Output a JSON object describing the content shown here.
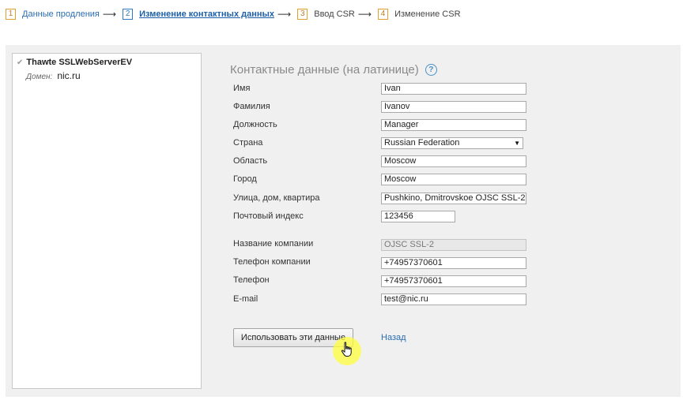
{
  "steps": [
    {
      "num": "1",
      "label": "Данные продления"
    },
    {
      "num": "2",
      "label": "Изменение контактных данных"
    },
    {
      "num": "3",
      "label": "Ввод CSR"
    },
    {
      "num": "4",
      "label": "Изменение CSR"
    }
  ],
  "arrow": "⟶",
  "product": {
    "name": "Thawte SSLWebServerEV",
    "domain_label": "Домен:",
    "domain_value": "nic.ru"
  },
  "form": {
    "title": "Контактные данные (на латинице)",
    "help_glyph": "?",
    "fields": {
      "first_name": {
        "label": "Имя",
        "value": "Ivan"
      },
      "last_name": {
        "label": "Фамилия",
        "value": "Ivanov"
      },
      "position": {
        "label": "Должность",
        "value": "Manager"
      },
      "country": {
        "label": "Страна",
        "value": "Russian Federation"
      },
      "region": {
        "label": "Область",
        "value": "Moscow"
      },
      "city": {
        "label": "Город",
        "value": "Moscow"
      },
      "street": {
        "label": "Улица, дом, квартира",
        "value": "Pushkino, Dmitrovskoe OJSC SSL-2"
      },
      "zip": {
        "label": "Почтовый индекс",
        "value": "123456"
      },
      "company": {
        "label": "Название компании",
        "value": "OJSC SSL-2"
      },
      "company_phone": {
        "label": "Телефон компании",
        "value": "+74957370601"
      },
      "phone": {
        "label": "Телефон",
        "value": "+74957370601"
      },
      "email": {
        "label": "E-mail",
        "value": "test@nic.ru"
      }
    },
    "submit_label": "Использовать эти данные",
    "back_label": "Назад"
  },
  "colors": {
    "link": "#2a6db3",
    "step_border": "#e0a030",
    "panel_bg": "#f0f0f0",
    "cursor_highlight": "#ffff3c"
  }
}
